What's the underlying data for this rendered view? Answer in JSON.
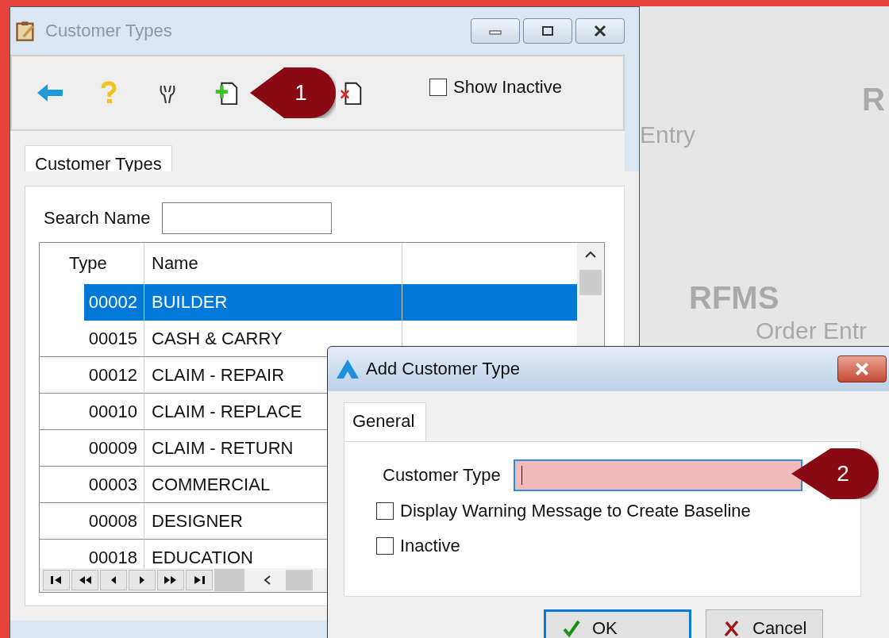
{
  "background_logo": {
    "texts": [
      "Entry",
      "R",
      "RFMS",
      "Order Entr"
    ]
  },
  "main_window": {
    "title": "Customer Types",
    "toolbar": {
      "show_inactive": {
        "label": "Show Inactive",
        "checked": false
      }
    },
    "tab": {
      "label": "Customer Types",
      "selected": true
    },
    "search": {
      "label": "Search Name"
    },
    "table": {
      "columns": [
        "Type",
        "Name"
      ],
      "rows": [
        {
          "type": "00002",
          "name": "BUILDER",
          "selected": true
        },
        {
          "type": "00015",
          "name": "CASH & CARRY",
          "selected": false
        },
        {
          "type": "00012",
          "name": "CLAIM - REPAIR",
          "selected": false
        },
        {
          "type": "00010",
          "name": "CLAIM - REPLACE",
          "selected": false
        },
        {
          "type": "00009",
          "name": "CLAIM - RETURN",
          "selected": false
        },
        {
          "type": "00003",
          "name": "COMMERCIAL",
          "selected": false
        },
        {
          "type": "00008",
          "name": "DESIGNER",
          "selected": false
        },
        {
          "type": "00018",
          "name": "EDUCATION",
          "selected": false
        }
      ]
    }
  },
  "dialog": {
    "title": "Add Customer Type",
    "tab": {
      "label": "General",
      "selected": true
    },
    "field": {
      "label": "Customer Type",
      "invalid": true
    },
    "checkboxes": [
      {
        "label": "Display Warning Message to Create Baseline",
        "checked": false
      },
      {
        "label": "Inactive",
        "checked": false
      }
    ],
    "buttons": [
      {
        "label": "OK",
        "kind": "ok",
        "default": true
      },
      {
        "label": "Cancel",
        "kind": "cancel",
        "default": false
      }
    ]
  },
  "callouts": [
    {
      "number": "1"
    },
    {
      "number": "2"
    }
  ]
}
